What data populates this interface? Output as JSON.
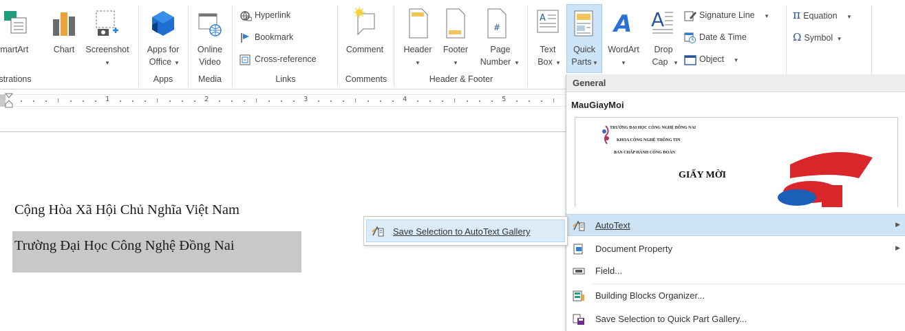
{
  "ribbon": {
    "illustrations": {
      "smartart": "SmartArt",
      "chart": "Chart",
      "screenshot": "Screenshot",
      "group_label": "Illustrations"
    },
    "apps": {
      "apps_for_office_line1": "Apps for",
      "apps_for_office_line2": "Office",
      "group_label": "Apps"
    },
    "media": {
      "online_video_line1": "Online",
      "online_video_line2": "Video",
      "group_label": "Media"
    },
    "links": {
      "hyperlink": "Hyperlink",
      "bookmark": "Bookmark",
      "cross_reference": "Cross-reference",
      "group_label": "Links"
    },
    "comments": {
      "comment": "Comment",
      "group_label": "Comments"
    },
    "header_footer": {
      "header": "Header",
      "footer": "Footer",
      "page_number_line1": "Page",
      "page_number_line2": "Number",
      "group_label": "Header & Footer"
    },
    "text": {
      "text_box_line1": "Text",
      "text_box_line2": "Box",
      "quick_parts_line1": "Quick",
      "quick_parts_line2": "Parts",
      "wordart": "WordArt",
      "drop_cap_line1": "Drop",
      "drop_cap_line2": "Cap",
      "signature_line": "Signature Line",
      "date_time": "Date & Time",
      "object": "Object"
    },
    "symbols": {
      "equation": "Equation",
      "symbol": "Symbol"
    }
  },
  "ruler": {
    "numbers": [
      "1",
      "2",
      "3",
      "4",
      "5"
    ]
  },
  "document": {
    "line1": "Cộng Hòa Xã Hội Chủ Nghĩa Việt Nam",
    "line2": "Trường Đại Học Công Nghệ Đồng Nai"
  },
  "quick_parts_menu": {
    "section_header": "General",
    "entry_name": "MauGiayMoi",
    "preview": {
      "line1": "TRƯỜNG ĐẠI HỌC CÔNG NGHỆ ĐỒNG NAI",
      "line2": "KHOA CÔNG NGHỆ THÔNG TIN",
      "line3": "BAN CHẤP HÀNH CÔNG ĐOÀN",
      "title": "GIẤY MỜI"
    },
    "items": [
      {
        "label": "AutoText",
        "icon": "autotext-icon",
        "has_submenu": true,
        "highlighted": true
      },
      {
        "label": "Document Property",
        "icon": "document-property-icon",
        "has_submenu": true
      },
      {
        "label": "Field...",
        "icon": "field-icon",
        "has_submenu": false
      },
      {
        "label": "Building Blocks Organizer...",
        "icon": "building-blocks-icon",
        "has_submenu": false
      },
      {
        "label": "Save Selection to Quick Part Gallery...",
        "icon": "save-selection-icon",
        "has_submenu": false
      }
    ]
  },
  "autotext_submenu": {
    "items": [
      {
        "label": "Save Selection to AutoText Gallery",
        "icon": "autotext-save-icon"
      }
    ]
  },
  "colors": {
    "accent_blue": "#2b579a",
    "menu_highlight": "#cde3f6",
    "selection_gray": "#c8c8c8",
    "quick_parts_pressed": "#cde3f6"
  }
}
